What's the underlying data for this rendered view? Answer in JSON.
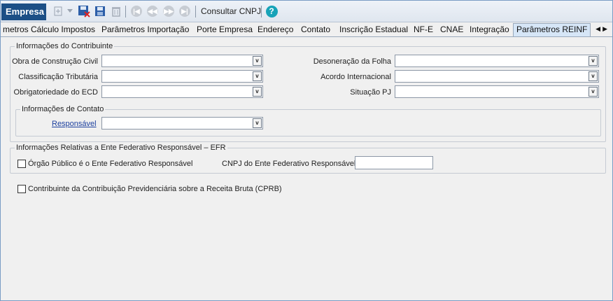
{
  "toolbar": {
    "title": "Empresa",
    "consult_label": "Consultar CNPJ",
    "help_label": "?"
  },
  "tabs": [
    {
      "label": "metros Cálculo Impostos"
    },
    {
      "label": "Parâmetros Importação"
    },
    {
      "label": "Porte Empresa"
    },
    {
      "label": "Endereço"
    },
    {
      "label": "Contato"
    },
    {
      "label": "Inscrição Estadual"
    },
    {
      "label": "NF-E"
    },
    {
      "label": "CNAE"
    },
    {
      "label": "Integração"
    },
    {
      "label": "Parâmetros REINF"
    }
  ],
  "contribuinte": {
    "legend": "Informações do Contribuinte",
    "obra_label": "Obra de Construção Civil",
    "classificacao_label": "Classificação Tributária",
    "obrigatoriedade_label": "Obrigatoriedade do ECD",
    "desoneracao_label": "Desoneração da Folha",
    "acordo_label": "Acordo Internacional",
    "situacao_label": "Situação PJ",
    "contato": {
      "legend": "Informações de Contato",
      "responsavel_label": "Responsável"
    }
  },
  "efr": {
    "legend": "Informações Relativas a Ente Federativo Responsável – EFR",
    "orgao_label": "Órgão Público é o Ente Federativo Responsável",
    "cnpj_label": "CNPJ do Ente Federativo Responsável",
    "cnpj_value": ""
  },
  "cprb_label": "Contribuinte da Contribuição Previdenciária sobre a Receita Bruta (CPRB)",
  "dropdown_glyph": "v"
}
